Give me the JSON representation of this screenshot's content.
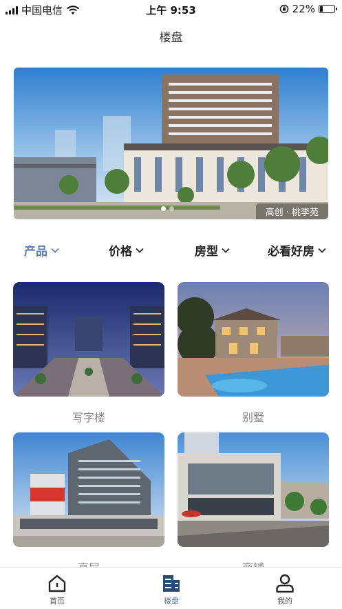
{
  "status_bar": {
    "carrier": "中国电信",
    "time": "上午 9:53",
    "battery": "22%",
    "battery_level": 0.22
  },
  "header": {
    "title": "楼盘"
  },
  "banner": {
    "caption": "高创 · 桃李苑",
    "slide_count": 2,
    "active_index": 0
  },
  "filters": [
    {
      "label": "产品",
      "active": true
    },
    {
      "label": "价格",
      "active": false
    },
    {
      "label": "房型",
      "active": false
    },
    {
      "label": "必看好房",
      "active": false
    }
  ],
  "categories": [
    {
      "label": "写字楼"
    },
    {
      "label": "别墅"
    },
    {
      "label": "高层"
    },
    {
      "label": "商铺"
    }
  ],
  "tab_bar": {
    "items": [
      {
        "label": "首页",
        "icon": "home-icon"
      },
      {
        "label": "楼盘",
        "icon": "building-icon",
        "active": true
      },
      {
        "label": "我的",
        "icon": "user-icon"
      }
    ]
  },
  "colors": {
    "accent": "#5a7ea6"
  }
}
